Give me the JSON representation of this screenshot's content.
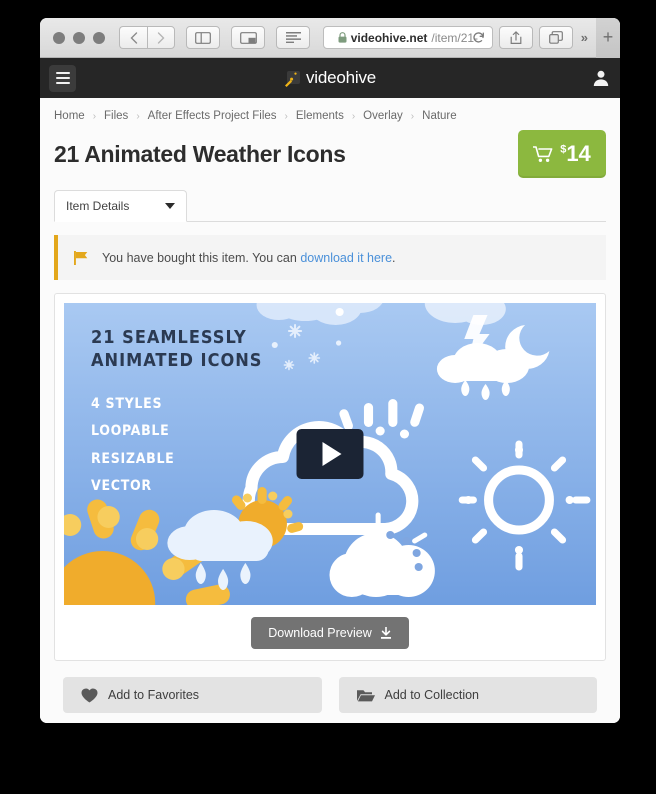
{
  "browser": {
    "url_host": "videohive.net",
    "url_path": "/item/21-",
    "lock_icon": "lock-icon",
    "back_icon": "chevron-left-icon",
    "forward_icon": "chevron-right-icon",
    "sidebar_icon": "sidebar-toggle-icon",
    "pip_icon": "picture-in-picture-icon",
    "reader_icon": "reader-view-icon",
    "reload_icon": "reload-icon",
    "share_icon": "share-icon",
    "tabs_icon": "show-tabs-icon",
    "overflow_label": "»",
    "newtab_label": "+"
  },
  "site_header": {
    "menu_icon": "hamburger-menu-icon",
    "logo_text": "videohive",
    "account_icon": "user-avatar-icon"
  },
  "breadcrumb": {
    "separator": "›",
    "items": [
      "Home",
      "Files",
      "After Effects Project Files",
      "Elements",
      "Overlay",
      "Nature"
    ]
  },
  "item": {
    "title": "21 Animated Weather Icons",
    "price_currency": "$",
    "price_amount": "14",
    "cart_icon": "shopping-cart-icon",
    "buy_color": "#8cb83f"
  },
  "tabs": {
    "active_label": "Item Details",
    "caret_icon": "chevron-down-icon"
  },
  "notice": {
    "flag_icon": "flag-icon",
    "text_before": "You have bought this item. You can ",
    "link_text": "download it here",
    "text_after": ".",
    "accent_color": "#e3a71c",
    "link_color": "#4a90d9"
  },
  "preview": {
    "headline": "21 SEAMLESSLY\nANIMATED ICONS",
    "features": [
      "4 STYLES",
      "LOOPABLE",
      "RESIZABLE",
      "VECTOR"
    ],
    "play_icon": "play-button-icon",
    "download_label": "Download Preview",
    "download_icon": "download-icon"
  },
  "actions": [
    {
      "label": "Add to Favorites",
      "icon": "heart-icon"
    },
    {
      "label": "Add to Collection",
      "icon": "folder-icon"
    }
  ]
}
